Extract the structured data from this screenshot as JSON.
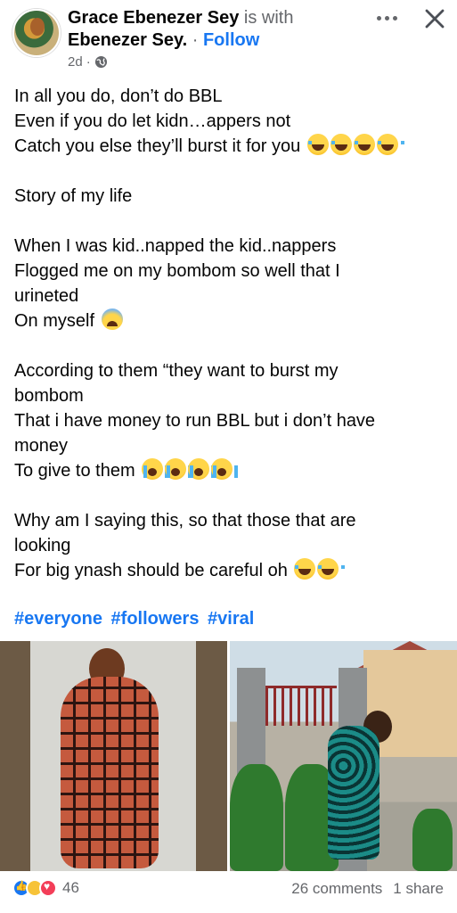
{
  "header": {
    "author": "Grace Ebenezer Sey",
    "with_text": "is with",
    "tagged": "Ebenezer Sey",
    "dot": ".",
    "separator": "·",
    "follow_label": "Follow",
    "time": "2d",
    "meta_separator": "·",
    "privacy_icon": "globe-icon",
    "more_icon": "more-options-icon",
    "close_icon": "close-icon"
  },
  "post": {
    "lines": [
      "In all you do, don’t do BBL",
      "Even if you do let kidn…appers not",
      "Catch you else they’ll burst it for you",
      "Story of my life",
      "When I was kid..napped  the kid..nappers",
      "Flogged me on my bombom so well that I",
      "urineted",
      "On myself",
      "According to them “they want to burst my",
      "bombom",
      "That i have money to run BBL but i don’t have",
      "money",
      "To give to them",
      ".",
      "Why am I saying this, so that those that are",
      "looking",
      "For big ynash should be careful oh"
    ],
    "hashtags": [
      "#everyone",
      "#followers",
      "#viral"
    ]
  },
  "footer": {
    "reaction_icons": [
      "like-icon",
      "sad-icon",
      "love-icon"
    ],
    "reaction_count": "46",
    "comments": "26 comments",
    "shares": "1 share"
  },
  "colors": {
    "link": "#1877f2",
    "muted": "#65676b",
    "text": "#050505"
  }
}
